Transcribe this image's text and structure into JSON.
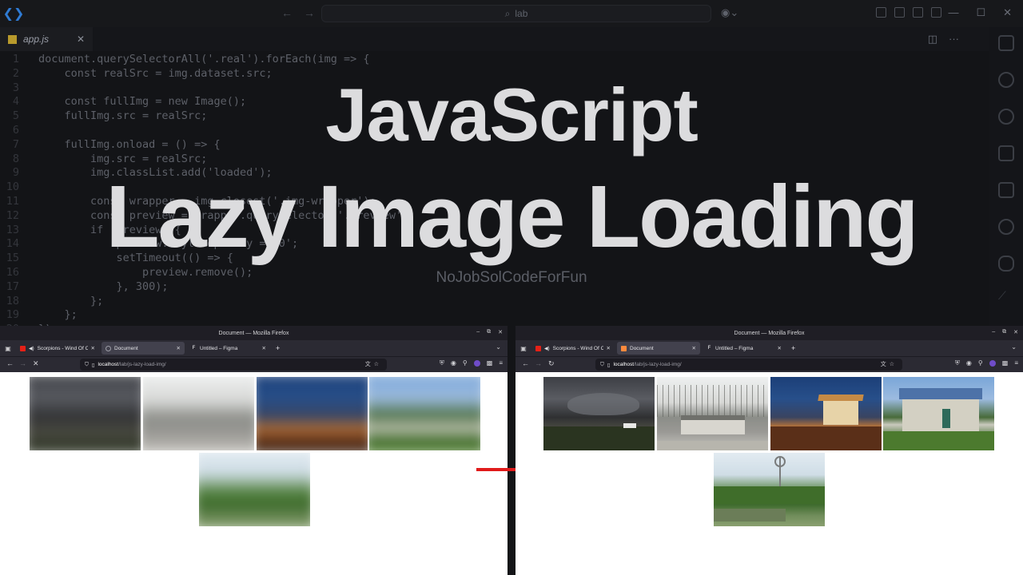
{
  "vscode": {
    "search_text": "lab",
    "active_tab": "app.js",
    "code_lines": [
      {
        "n": "1",
        "text": "document.querySelectorAll('.real').forEach(img => {"
      },
      {
        "n": "2",
        "text": "    const realSrc = img.dataset.src;"
      },
      {
        "n": "3",
        "text": ""
      },
      {
        "n": "4",
        "text": "    const fullImg = new Image();"
      },
      {
        "n": "5",
        "text": "    fullImg.src = realSrc;"
      },
      {
        "n": "6",
        "text": ""
      },
      {
        "n": "7",
        "text": "    fullImg.onload = () => {"
      },
      {
        "n": "8",
        "text": "        img.src = realSrc;"
      },
      {
        "n": "9",
        "text": "        img.classList.add('loaded');"
      },
      {
        "n": "10",
        "text": ""
      },
      {
        "n": "11",
        "text": "        const wrapper = img.closest('.img-wrapper');"
      },
      {
        "n": "12",
        "text": "        const preview = wrapper.querySelector('.preview');"
      },
      {
        "n": "13",
        "text": "        if (preview) {"
      },
      {
        "n": "14",
        "text": "            preview.style.opacity = '0';"
      },
      {
        "n": "15",
        "text": "            setTimeout(() => {"
      },
      {
        "n": "16",
        "text": "                preview.remove();"
      },
      {
        "n": "17",
        "text": "            }, 300);"
      },
      {
        "n": "18",
        "text": "        };"
      },
      {
        "n": "19",
        "text": "    };"
      },
      {
        "n": "20",
        "text": "});"
      }
    ]
  },
  "overlay": {
    "title_line1": "JavaScript",
    "title_line2": "Lazy Image Loading",
    "channel": "NoJobSolCodeForFun"
  },
  "browser": {
    "window_title": "Document — Mozilla Firefox",
    "tabs": [
      {
        "label": "Scorpions - Wind Of Ch",
        "favicon_color": "#e62117"
      },
      {
        "label": "Document",
        "favicon_color": "#ff8a3d"
      },
      {
        "label": "Untitled – Figma",
        "favicon_color": "#2b2a33"
      }
    ],
    "url_host": "localhost",
    "url_path": "/lab/js-lazy-load-img/",
    "left_state": "loading",
    "right_state": "loaded"
  },
  "images": [
    {
      "name": "storm-field"
    },
    {
      "name": "old-house"
    },
    {
      "name": "cabin-dusk"
    },
    {
      "name": "stone-cottage"
    },
    {
      "name": "windmill-pond"
    }
  ],
  "colors": {
    "arrow": "#e01b1b",
    "editor_bg": "#131417",
    "title_text": "#dcdcde"
  }
}
